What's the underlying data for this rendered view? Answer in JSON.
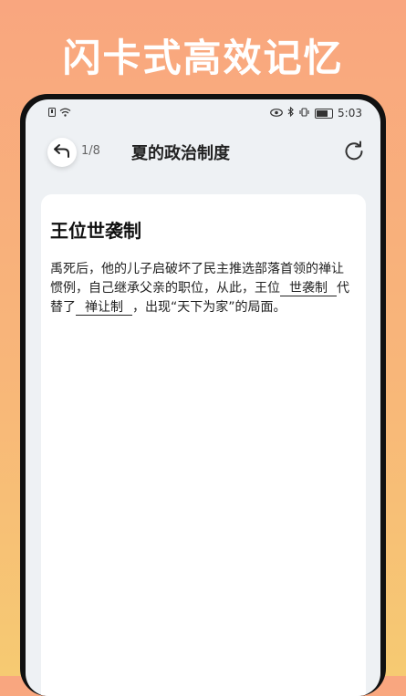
{
  "banner": {
    "text": "闪卡式高效记忆"
  },
  "status_bar": {
    "time": "5:03"
  },
  "header": {
    "counter": "1/8",
    "title": "夏的政治制度"
  },
  "card": {
    "heading": "王位世袭制",
    "body": {
      "part1": "禹死后，他的儿子启破坏了民主推选部落首领的禅让惯例，自己继承父亲的职位，从此，王位",
      "blank1": "世袭制",
      "part2": "代替了",
      "blank2": "禅让制",
      "part3": "，出现“天下为家”的局面。"
    }
  }
}
